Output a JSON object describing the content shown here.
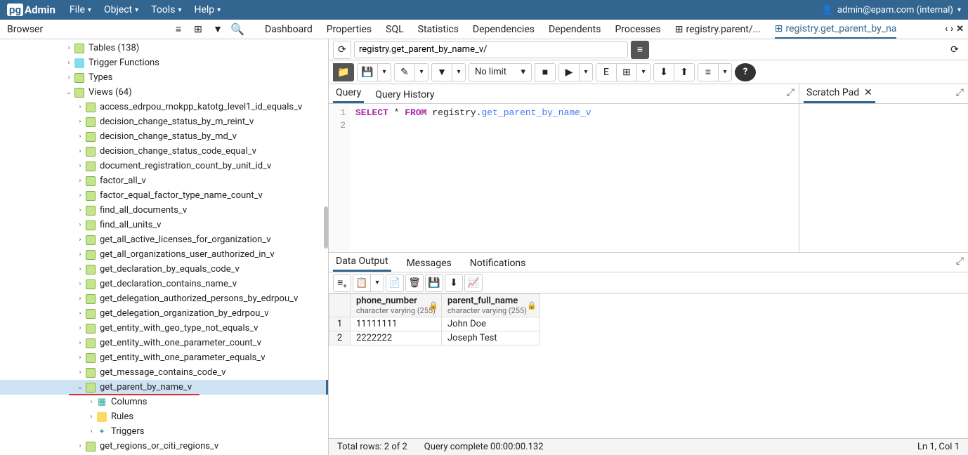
{
  "header": {
    "logo_pg": "pg",
    "logo_admin": "Admin",
    "menus": [
      "File",
      "Object",
      "Tools",
      "Help"
    ],
    "user": "admin@epam.com (internal)"
  },
  "browser_label": "Browser",
  "main_tabs": {
    "items": [
      "Dashboard",
      "Properties",
      "SQL",
      "Statistics",
      "Dependencies",
      "Dependents",
      "Processes"
    ],
    "extra1": "registry.parent/...",
    "extra2": "registry.get_parent_by_na"
  },
  "tree": {
    "tables": "Tables (138)",
    "trigger_functions": "Trigger Functions",
    "types": "Types",
    "views": "Views (64)",
    "view_items": [
      "access_edrpou_rnokpp_katotg_level1_id_equals_v",
      "decision_change_status_by_m_reint_v",
      "decision_change_status_by_md_v",
      "decision_change_status_code_equal_v",
      "document_registration_count_by_unit_id_v",
      "factor_all_v",
      "factor_equal_factor_type_name_count_v",
      "find_all_documents_v",
      "find_all_units_v",
      "get_all_active_licenses_for_organization_v",
      "get_all_organizations_user_authorized_in_v",
      "get_declaration_by_equals_code_v",
      "get_declaration_contains_name_v",
      "get_delegation_authorized_persons_by_edrpou_v",
      "get_delegation_organization_by_edrpou_v",
      "get_entity_with_geo_type_not_equals_v",
      "get_entity_with_one_parameter_count_v",
      "get_entity_with_one_parameter_equals_v",
      "get_message_contains_code_v",
      "get_parent_by_name_v"
    ],
    "columns_label": "Columns",
    "rules_label": "Rules",
    "triggers_label": "Triggers",
    "last_item": "get_regions_or_citi_regions_v"
  },
  "path_value": "registry.get_parent_by_name_v/",
  "no_limit_label": "No limit",
  "editor": {
    "query_tab": "Query",
    "history_tab": "Query History",
    "scratch_tab": "Scratch Pad",
    "line1": "1",
    "line2": "2",
    "sql_select": "SELECT",
    "sql_star": "*",
    "sql_from": "FROM",
    "sql_schema": "registry.",
    "sql_view": "get_parent_by_name_v"
  },
  "output": {
    "data_tab": "Data Output",
    "messages_tab": "Messages",
    "notifications_tab": "Notifications",
    "columns": [
      {
        "name": "phone_number",
        "type": "character varying (255)"
      },
      {
        "name": "parent_full_name",
        "type": "character varying (255)"
      }
    ],
    "rows": [
      {
        "n": "1",
        "c0": "11111111",
        "c1": "John Doe"
      },
      {
        "n": "2",
        "c0": "2222222",
        "c1": "Joseph Test"
      }
    ]
  },
  "status": {
    "rows": "Total rows: 2 of 2",
    "time": "Query complete 00:00:00.132",
    "pos": "Ln 1, Col 1"
  }
}
